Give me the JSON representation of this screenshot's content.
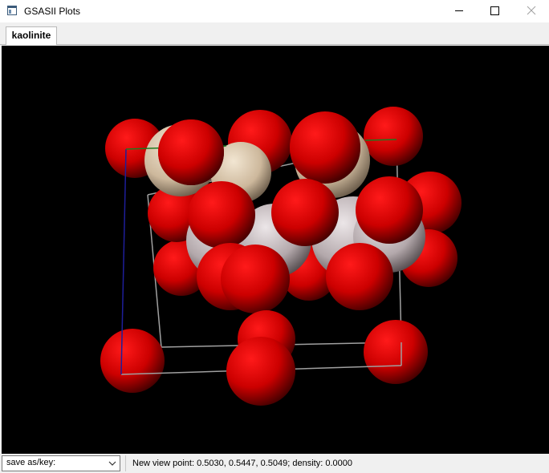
{
  "window": {
    "title": "GSASII Plots",
    "icon": "app-window-icon",
    "controls": [
      "minimize-icon",
      "maximize-icon",
      "close-icon"
    ]
  },
  "tabs": [
    {
      "label": "kaolinite",
      "active": true
    }
  ],
  "viewport": {
    "background": "#000000",
    "atom_colors": {
      "oxygen": "#d40000",
      "silicon": "#d8c4a8",
      "aluminium": "#bdb3b5"
    },
    "cell_axis_colors": {
      "a": "#1f8c1f",
      "b": "#2020c0",
      "c": "#a0a0a0"
    }
  },
  "statusbar": {
    "save_as_label": "save as/key:",
    "status_text": "New view point: 0.5030, 0.5447, 0.5049; density: 0.0000"
  }
}
